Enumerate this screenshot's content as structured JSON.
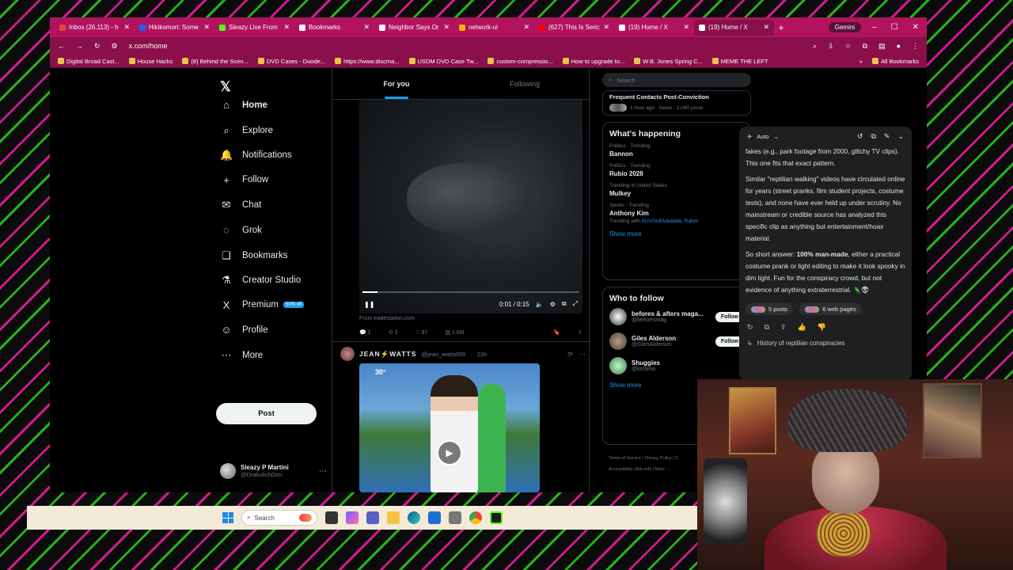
{
  "browser": {
    "tabs": [
      {
        "title": "Inbox (26,113) - h",
        "color": "#ea4335"
      },
      {
        "title": "Hikikomori: Some",
        "color": "#1d63ed"
      },
      {
        "title": "Sleazy Live From",
        "color": "#53fc18"
      },
      {
        "title": "Bookmarks",
        "color": "#ffffff"
      },
      {
        "title": "Neighbor Says Or",
        "color": "#ffffff"
      },
      {
        "title": "network-ui",
        "color": "#f4b400"
      },
      {
        "title": "(627) This Is Seric",
        "color": "#ff0000"
      },
      {
        "title": "(19) Home / X",
        "color": "#ffffff"
      },
      {
        "title": "(19) Home / X",
        "color": "#ffffff"
      }
    ],
    "new_tab": "+",
    "gemini_label": "Gemini",
    "url": "x.com/home",
    "bookmarks": [
      "Digital Broad Cast...",
      "House Hacks",
      "(8) Behind the Scen...",
      "DVD Cases - Duode...",
      "https://www.discma...",
      "USDM DVD Case Tw...",
      "custom-compressio...",
      "How to upgrade to...",
      "W.B. Jones Spring C...",
      "MEME THE LEFT"
    ],
    "all_bookmarks": "All Bookmarks"
  },
  "nav": {
    "items": [
      {
        "label": "Home",
        "icon": "⌂"
      },
      {
        "label": "Explore",
        "icon": "⌕"
      },
      {
        "label": "Notifications",
        "icon": "🔔"
      },
      {
        "label": "Follow",
        "icon": "+"
      },
      {
        "label": "Chat",
        "icon": "✉"
      },
      {
        "label": "Grok",
        "icon": "◌"
      },
      {
        "label": "Bookmarks",
        "icon": "❏"
      },
      {
        "label": "Creator Studio",
        "icon": "⚗"
      },
      {
        "label": "Premium",
        "icon": "X"
      },
      {
        "label": "Profile",
        "icon": "☺"
      },
      {
        "label": "More",
        "icon": "⋯"
      }
    ],
    "premium_badge": "50% off",
    "post_button": "Post",
    "user_name": "Sleazy P Martini",
    "user_handle": "@DrakulichDon"
  },
  "feed": {
    "tab_for_you": "For you",
    "tab_following": "Following",
    "video1": {
      "time": "0:01 / 0:15",
      "progress": 0.07,
      "source": "From tradestation.com",
      "replies": "1",
      "reposts": "3",
      "likes": "87",
      "views": "1.6M"
    },
    "post2": {
      "name": "JEAN⚡WATTS",
      "handle": "@jean_watts659",
      "time": "23h",
      "temp": "30°"
    }
  },
  "right": {
    "search_placeholder": "Search",
    "top_card_title": "Frequent Contacts Post-Conviction",
    "top_card_meta": "1 hour ago · News · 2,040 posts",
    "whats_happening": "What's happening",
    "trends": [
      {
        "category": "Politics · Trending",
        "name": "Bannon",
        "sub": ""
      },
      {
        "category": "Politics · Trending",
        "name": "Rubio 2028",
        "sub": ""
      },
      {
        "category": "Trending in United States",
        "name": "Mulkey",
        "sub": ""
      },
      {
        "category": "Sports · Trending",
        "name": "Anthony Kim",
        "sub_prefix": "Trending with",
        "sub": "#LIVGolfAdelaide, Rahm"
      }
    ],
    "show_more": "Show more",
    "who_to_follow": "Who to follow",
    "follows": [
      {
        "name": "befores & afters maga...",
        "handle": "@beforesmag",
        "button": "Follow"
      },
      {
        "name": "Giles Alderson",
        "handle": "@GilesAlderson",
        "button": "Follow"
      },
      {
        "name": "Shuggies",
        "handle": "@krstena",
        "button": ""
      }
    ],
    "show_more_2": "Show more",
    "footer_line1": "Terms of Service  |  Privacy Policy  |  C",
    "footer_line2": "Accessibility  |  Ads info  |  More ···"
  },
  "gemini": {
    "mode": "Auto",
    "para1": "fakes (e.g., park footage from 2000, glitchy TV clips). This one fits that exact pattern.",
    "para2": "Similar \"reptilian walking\" videos have circulated online for years (street pranks, film student projects, costume tests), and none have ever held up under scrutiny. No mainstream or credible source has analyzed this specific clip as anything but entertainment/hoax material.",
    "para3_pre": "So short answer: ",
    "para3_bold": "100% man-made",
    "para3_post": ", either a practical costume prank or light editing to make it look spooky in dim light. Fun for the conspiracy crowd, but not evidence of anything extraterrestrial. 🦎👽",
    "chip_posts": "5 posts",
    "chip_pages": "6 web pages",
    "suggestion": "History of reptilian conspiracies"
  },
  "taskbar": {
    "search_label": "Search"
  }
}
